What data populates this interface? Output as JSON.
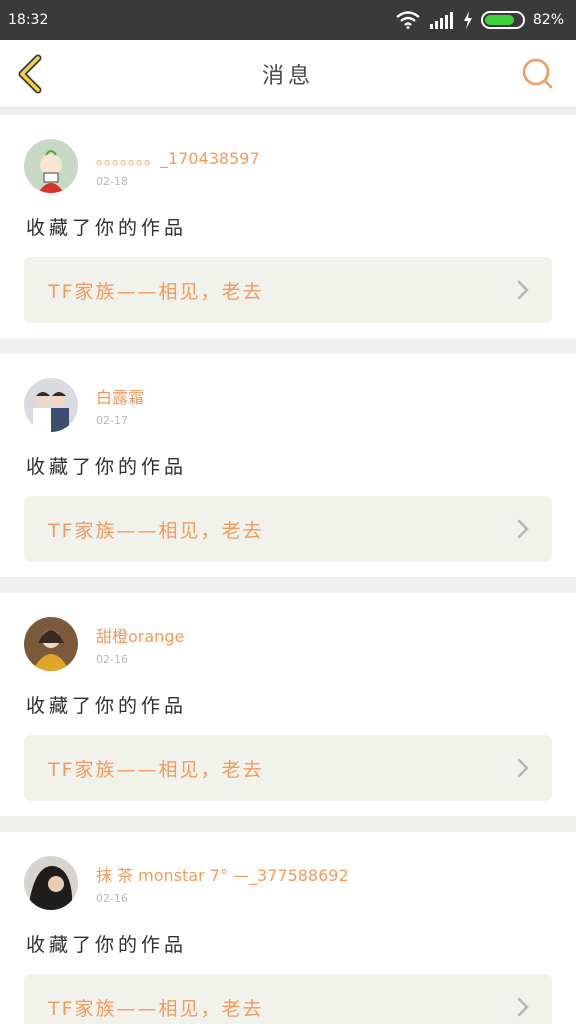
{
  "status": {
    "time": "18:32",
    "battery": "82%",
    "battery_level": 0.82
  },
  "header": {
    "title": "消息"
  },
  "notifications": [
    {
      "username": "。。。。。。。_170438597",
      "date": "02-18",
      "action": "收藏了你的作品",
      "work": "TF家族——相见，老去",
      "avatar_color": "#c7d9c4"
    },
    {
      "username": "白露霜",
      "date": "02-17",
      "action": "收藏了你的作品",
      "work": "TF家族——相见，老去",
      "avatar_color": "#d9dbe0"
    },
    {
      "username": "甜橙orange",
      "date": "02-16",
      "action": "收藏了你的作品",
      "work": "TF家族——相见，老去",
      "avatar_color": "#7b5a3c"
    },
    {
      "username": "抹 茶 monstar 7° —_377588692",
      "date": "02-16",
      "action": "收藏了你的作品",
      "work": "TF家族——相见，老去",
      "avatar_color": "#2c2a28"
    }
  ],
  "colors": {
    "accent": "#f29a5c",
    "back_icon": "#f2d24a"
  }
}
